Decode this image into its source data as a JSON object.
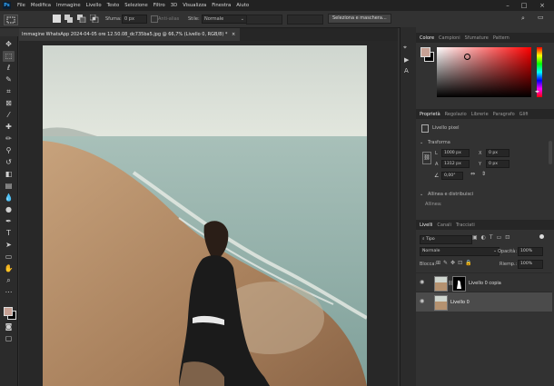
{
  "menubar": {
    "app_badge": "Ps",
    "items": [
      "File",
      "Modifica",
      "Immagine",
      "Livello",
      "Testo",
      "Selezione",
      "Filtro",
      "3D",
      "Visualizza",
      "Finestra",
      "Aiuto"
    ]
  },
  "options_bar": {
    "sfuma_label": "Sfuma:",
    "sfuma_value": "0 px",
    "antialias_label": "Anti-alias",
    "stile_label": "Stile:",
    "stile_value": "Normale",
    "select_mask_button": "Seleziona e maschera..."
  },
  "document": {
    "tab_title": "Immagine WhatsApp 2024-04-05 ore 12.50.08_dc735ba5.jpg @ 66,7% (Livello 0, RGB/8) *",
    "tab_close": "×"
  },
  "color_panel": {
    "tabs": [
      "Colore",
      "Campioni",
      "Sfumature",
      "Pattern"
    ],
    "active_tab": "Colore",
    "fg_color": "#c7a195",
    "bg_color": "#000000"
  },
  "properties_panel": {
    "tabs": [
      "Proprietà",
      "Regolazio",
      "Librerie",
      "Paragrafo",
      "Glifi"
    ],
    "active_tab": "Proprietà",
    "layer_type": "Livello pixel",
    "section_transform": "Trasforma",
    "w_label": "L",
    "w_value": "1000 px",
    "h_label": "A",
    "h_value": "1312 px",
    "x_label": "X",
    "x_value": "0 px",
    "y_label": "Y",
    "y_value": "0 px",
    "angle_value": "0,00°",
    "section_align": "Allinea e distribuisci",
    "align_label": "Allinea:"
  },
  "layers_panel": {
    "tabs": [
      "Livelli",
      "Canali",
      "Tracciati"
    ],
    "active_tab": "Livelli",
    "filter_kind": "Tipo",
    "blend_mode": "Normale",
    "opacity_label": "Opacità:",
    "opacity_value": "100%",
    "lock_label": "Blocca:",
    "fill_label": "Riemp.:",
    "fill_value": "100%",
    "layers": [
      {
        "name": "Livello 0 copia"
      },
      {
        "name": "Livello 0"
      }
    ]
  },
  "icons": {
    "move": "move-icon",
    "marquee": "rect-marquee-icon",
    "eye": "eye-icon"
  }
}
